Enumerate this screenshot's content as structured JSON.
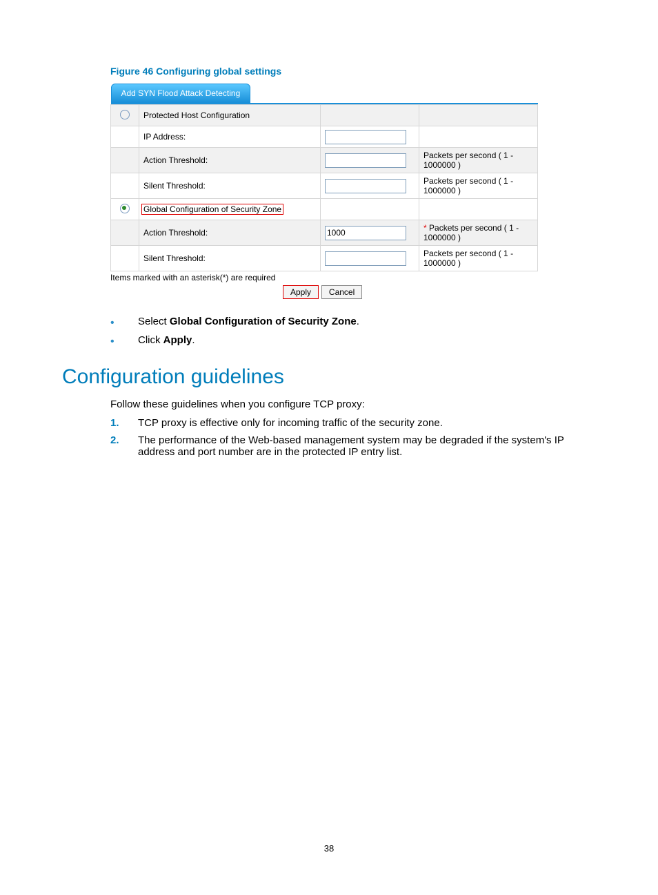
{
  "figure": {
    "caption": "Figure 46 Configuring global settings",
    "tab_label": "Add SYN Flood Attack Detecting",
    "protected_host_label": "Protected Host Configuration",
    "global_zone_label": "Global Configuration of Security Zone",
    "rows": {
      "ip_address_label": "IP Address:",
      "action_threshold_label": "Action Threshold:",
      "silent_threshold_label": "Silent Threshold:"
    },
    "hints": {
      "pps": "Packets per second ( 1 - 1000000 )",
      "pps_required_prefix": "*"
    },
    "values": {
      "global_action_threshold": "1000"
    },
    "note": "Items marked with an asterisk(*) are required",
    "buttons": {
      "apply": "Apply",
      "cancel": "Cancel"
    }
  },
  "bullets": {
    "select_pre": "Select ",
    "select_bold": "Global Configuration of Security Zone",
    "select_post": ".",
    "click_pre": "Click ",
    "click_bold": "Apply",
    "click_post": "."
  },
  "heading": "Configuration guidelines",
  "intro": "Follow these guidelines when you configure TCP proxy:",
  "guidelines": [
    "TCP proxy is effective only for incoming traffic of the security zone.",
    "The performance of the Web-based management system may be degraded if the system's IP address and port number are in the protected IP entry list."
  ],
  "page_number": "38"
}
